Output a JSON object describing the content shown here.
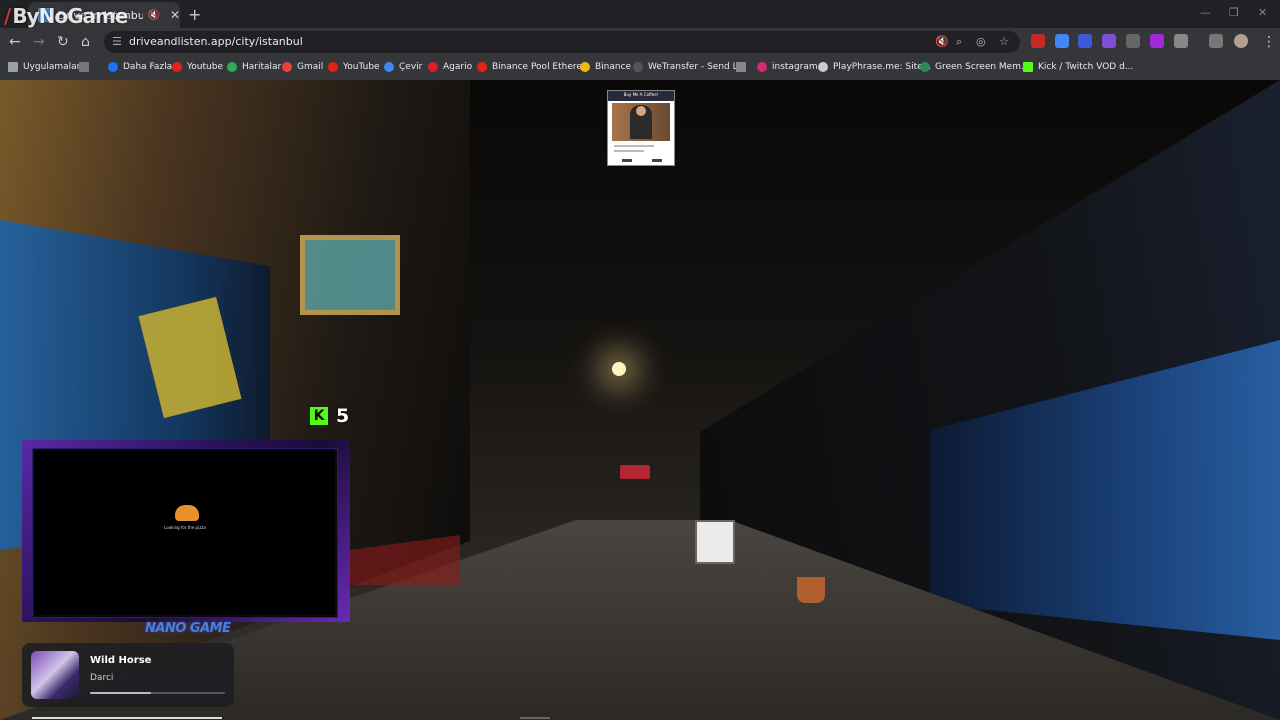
{
  "browser": {
    "watermark": "ByNoGame",
    "tab_title": "Drive in Istanbul, Turkey - Drive",
    "url": "driveandlisten.app/city/istanbul",
    "bookmarks": [
      {
        "label": "Uygulamalar",
        "color": "#9aa0a6"
      },
      {
        "label": "Daha Fazla",
        "color": "#1877f2"
      },
      {
        "label": "Youtube",
        "color": "#e62117"
      },
      {
        "label": "Haritalar",
        "color": "#34a853"
      },
      {
        "label": "Gmail",
        "color": "#ea4335"
      },
      {
        "label": "YouTube",
        "color": "#e62117"
      },
      {
        "label": "Çevir",
        "color": "#4285f4"
      },
      {
        "label": "Agario",
        "color": "#e01e2a"
      },
      {
        "label": "Binance Pool Ethere...",
        "color": "#e62117"
      },
      {
        "label": "Binance",
        "color": "#f0b90b"
      },
      {
        "label": "WeTransfer - Send L...",
        "color": "#555555"
      },
      {
        "label": "",
        "color": "#888888"
      },
      {
        "label": "instagram",
        "color": "#d62976"
      },
      {
        "label": "PlayPhrase.me: Site...",
        "color": "#cccccc"
      },
      {
        "label": "Green Screen Mem...",
        "color": "#2e8b57"
      },
      {
        "label": "Kick / Twitch VOD d...",
        "color": "#53fc18"
      }
    ]
  },
  "overlay": {
    "donate_title": "Buy Me A Coffee!",
    "kick_count": "5",
    "cam_loading_text": "Looking for the pizza",
    "cam_name": "NANO GAME"
  },
  "now_playing": {
    "track": "Wild Horse",
    "artist": "Darci",
    "progress": 0.45
  }
}
